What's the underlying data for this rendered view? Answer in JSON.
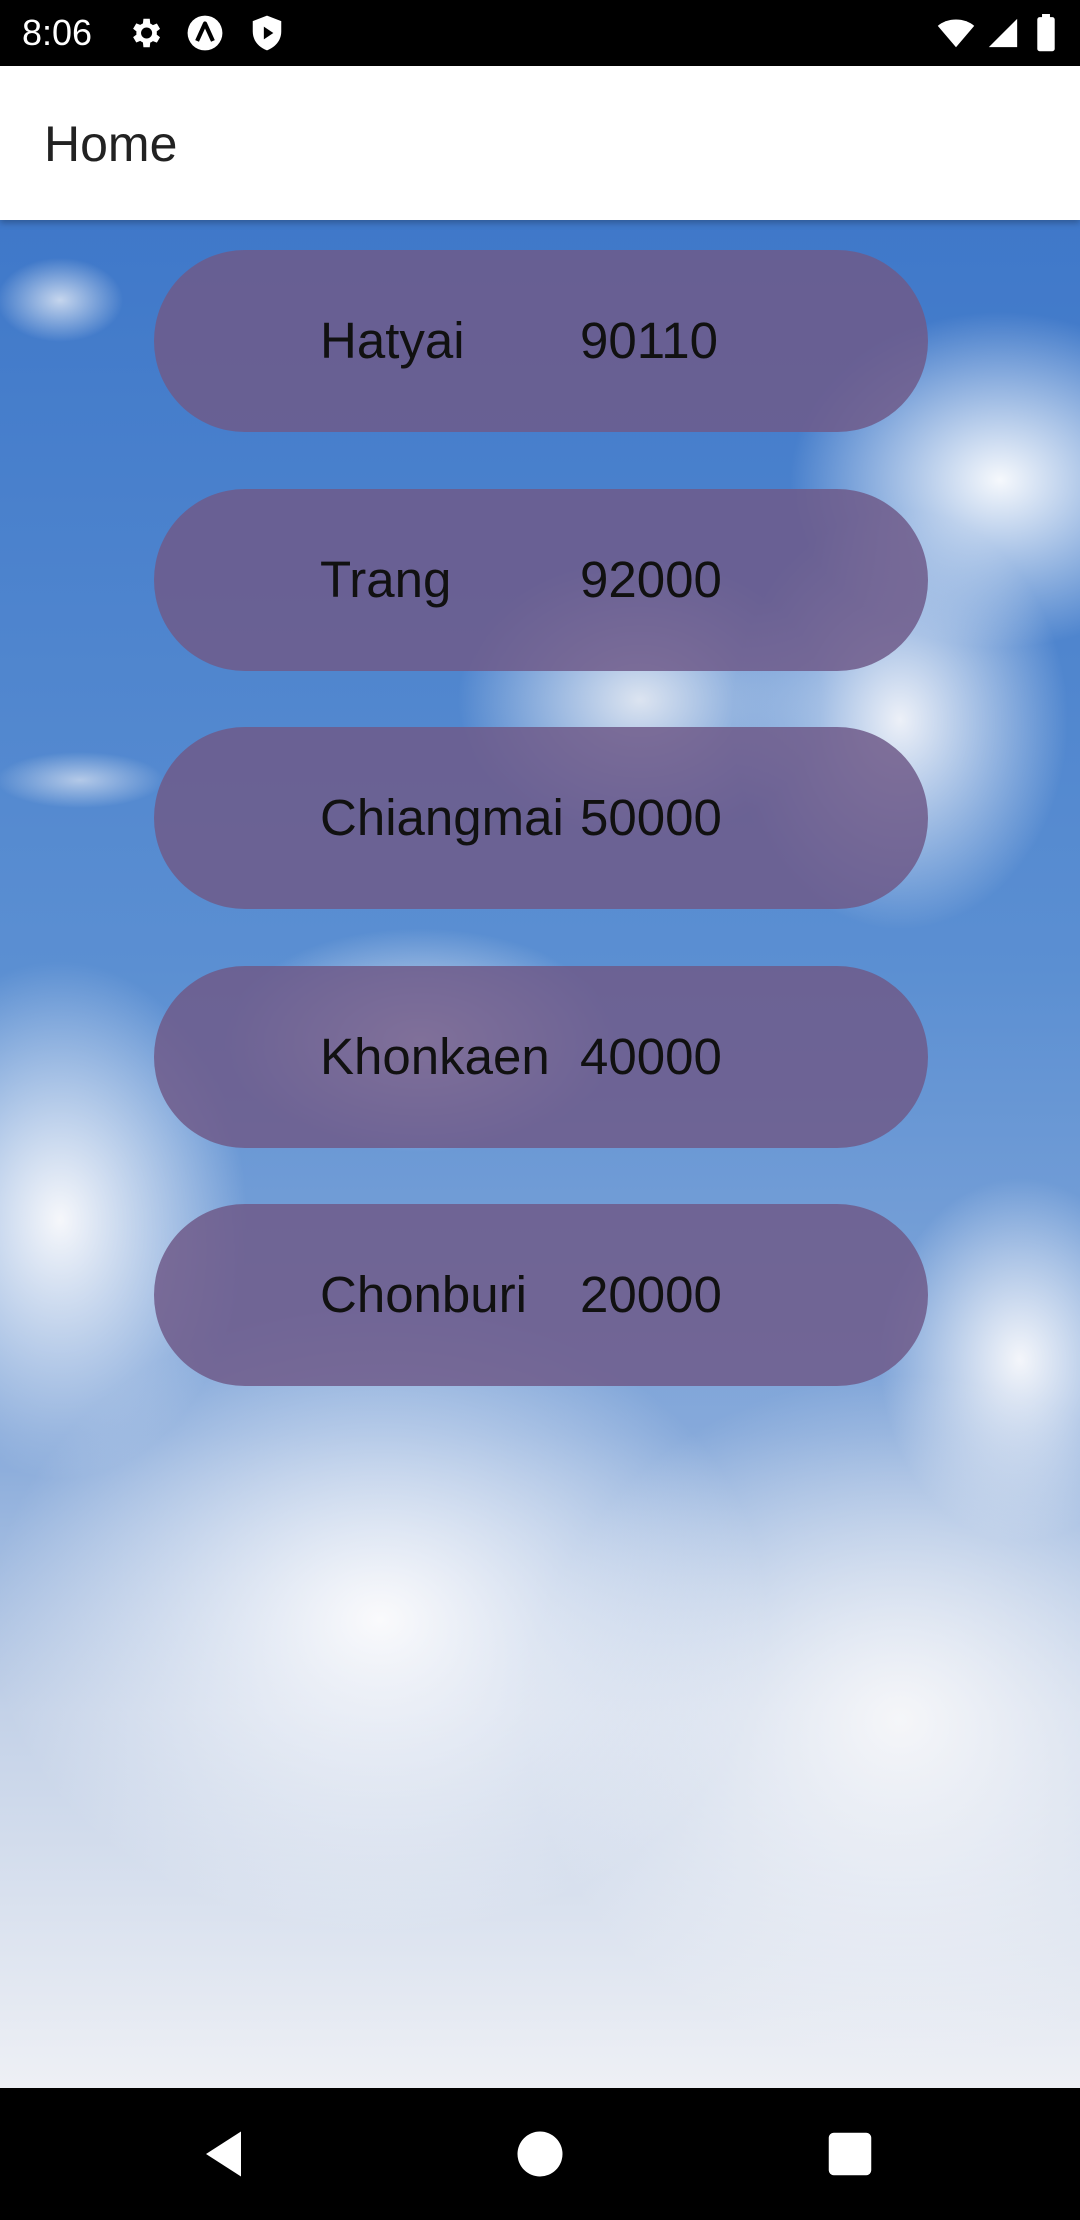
{
  "status_bar": {
    "time": "8:06",
    "left_icons": [
      "settings-gear-icon",
      "a-circle-icon",
      "shield-icon"
    ],
    "right_icons": [
      "wifi-icon",
      "signal-icon",
      "battery-icon"
    ]
  },
  "app_bar": {
    "title": "Home"
  },
  "list": {
    "items": [
      {
        "name": "Hatyai",
        "code": "90110"
      },
      {
        "name": "Trang",
        "code": "92000"
      },
      {
        "name": "Chiangmai",
        "code": "50000"
      },
      {
        "name": "Khonkaen",
        "code": "40000"
      },
      {
        "name": "Chonburi",
        "code": "20000"
      }
    ]
  },
  "nav_bar": {
    "buttons": [
      "back-icon",
      "home-icon",
      "recents-icon"
    ]
  },
  "colors": {
    "row_fill": "#6e5a8a",
    "sky_top": "#3f78c9",
    "app_bar_bg": "#ffffff"
  }
}
